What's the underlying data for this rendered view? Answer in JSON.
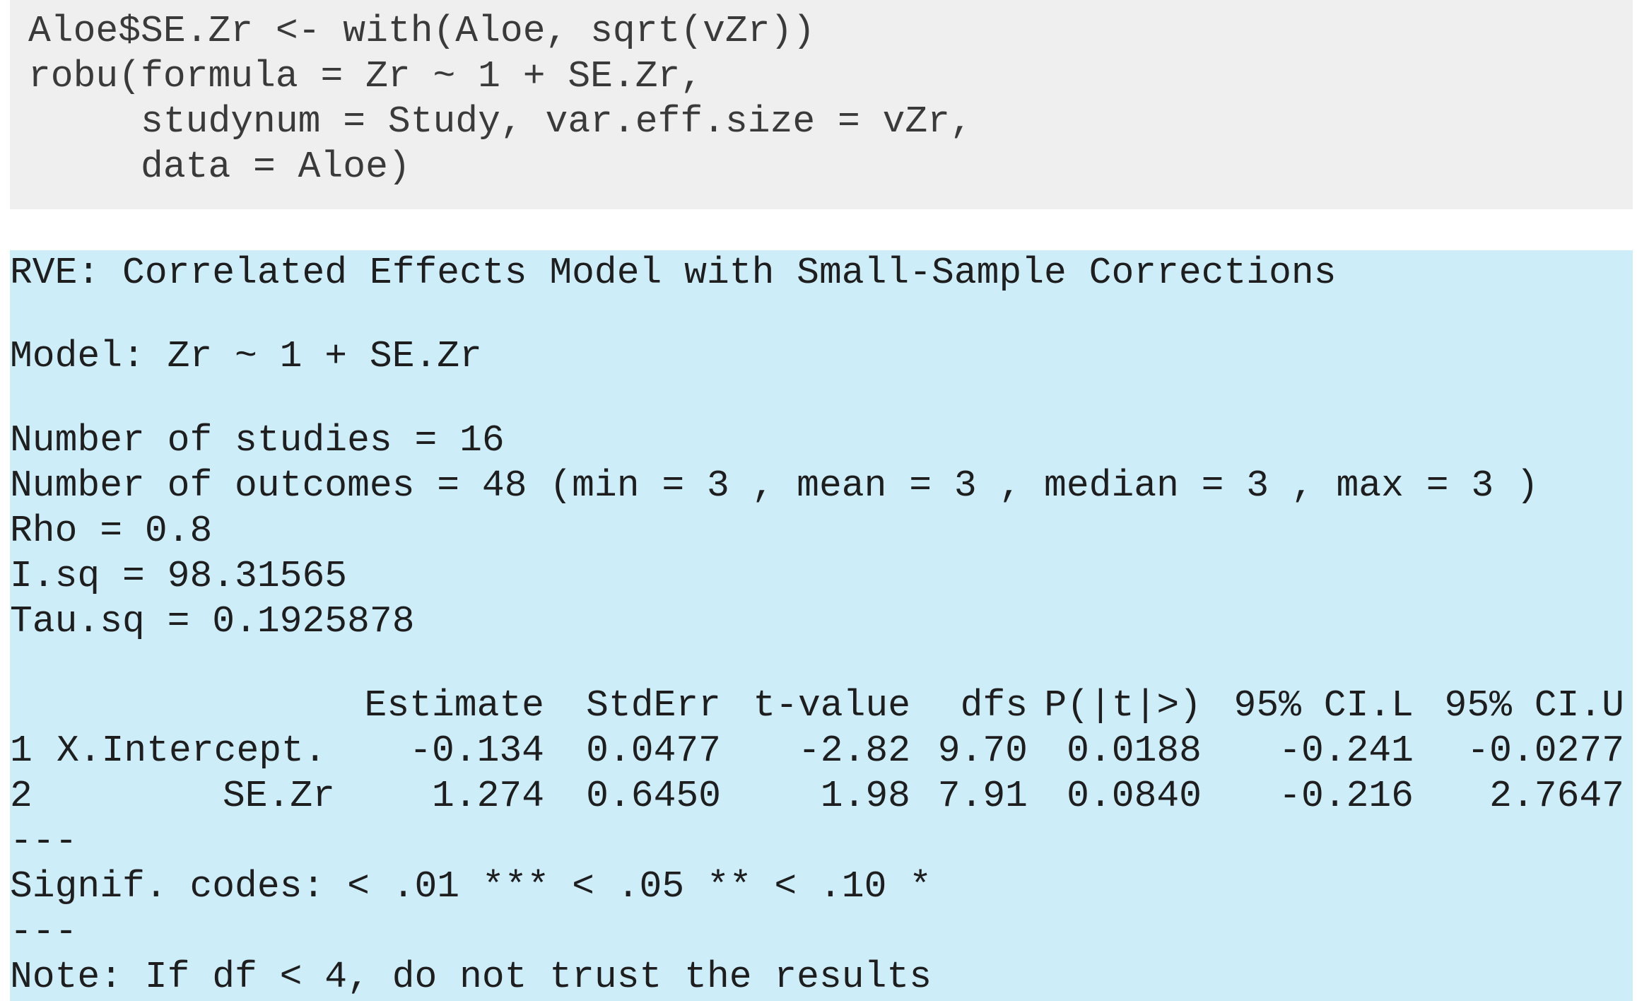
{
  "code": {
    "lines": [
      "Aloe$SE.Zr <- with(Aloe, sqrt(vZr))",
      "robu(formula = Zr ~ 1 + SE.Zr,",
      "     studynum = Study, var.eff.size = vZr,",
      "     data = Aloe)"
    ]
  },
  "output": {
    "header": "RVE: Correlated Effects Model with Small-Sample Corrections",
    "model": "Model: Zr ~ 1 + SE.Zr",
    "n_studies": "Number of studies = 16",
    "n_outcomes": "Number of outcomes = 48 (min = 3 , mean = 3 , median = 3 , max = 3 )",
    "rho": "Rho = 0.8",
    "isq": "I.sq = 98.31565",
    "tausq": "Tau.sq = 0.1925878",
    "table": {
      "columns": [
        "Estimate",
        "StdErr",
        "t-value",
        "dfs",
        "P(|t|>)",
        "95% CI.L",
        "95% CI.U"
      ],
      "rows": [
        {
          "index": "1",
          "name": "X.Intercept.",
          "values": [
            "-0.134",
            "0.0477",
            "-2.82",
            "9.70",
            "0.0188",
            "-0.241",
            "-0.0277"
          ]
        },
        {
          "index": "2",
          "name": "SE.Zr",
          "values": [
            "1.274",
            "0.6450",
            "1.98",
            "7.91",
            "0.0840",
            "-0.216",
            "2.7647"
          ]
        }
      ]
    },
    "sep1": "---",
    "signif": "Signif. codes: < .01 *** < .05 ** < .10 *",
    "sep2": "---",
    "note": "Note: If df < 4, do not trust the results"
  }
}
